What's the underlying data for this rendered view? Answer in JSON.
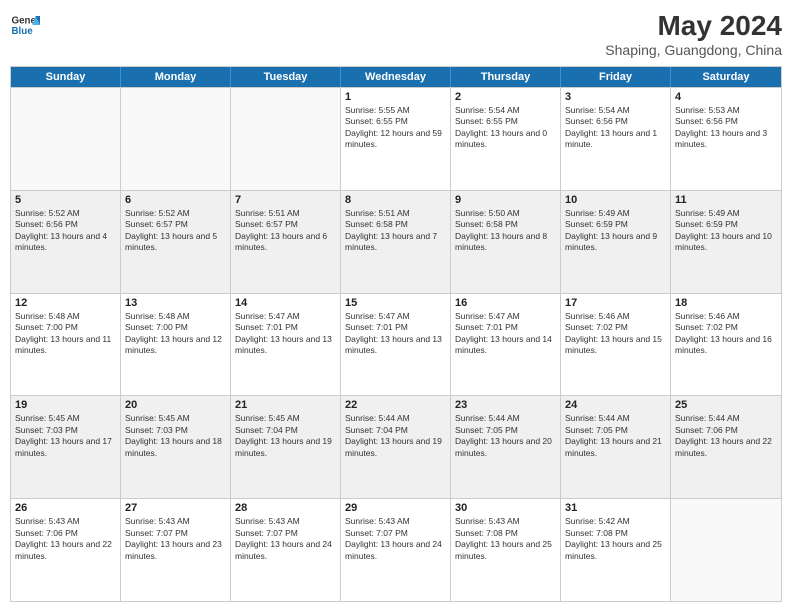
{
  "logo": {
    "line1": "General",
    "line2": "Blue"
  },
  "title": {
    "month_year": "May 2024",
    "location": "Shaping, Guangdong, China"
  },
  "days_of_week": [
    "Sunday",
    "Monday",
    "Tuesday",
    "Wednesday",
    "Thursday",
    "Friday",
    "Saturday"
  ],
  "weeks": [
    [
      {
        "day": "",
        "empty": true
      },
      {
        "day": "",
        "empty": true
      },
      {
        "day": "",
        "empty": true
      },
      {
        "day": "1",
        "sunrise": "5:55 AM",
        "sunset": "6:55 PM",
        "daylight": "12 hours and 59 minutes."
      },
      {
        "day": "2",
        "sunrise": "5:54 AM",
        "sunset": "6:55 PM",
        "daylight": "13 hours and 0 minutes."
      },
      {
        "day": "3",
        "sunrise": "5:54 AM",
        "sunset": "6:56 PM",
        "daylight": "13 hours and 1 minute."
      },
      {
        "day": "4",
        "sunrise": "5:53 AM",
        "sunset": "6:56 PM",
        "daylight": "13 hours and 3 minutes."
      }
    ],
    [
      {
        "day": "5",
        "sunrise": "5:52 AM",
        "sunset": "6:56 PM",
        "daylight": "13 hours and 4 minutes."
      },
      {
        "day": "6",
        "sunrise": "5:52 AM",
        "sunset": "6:57 PM",
        "daylight": "13 hours and 5 minutes."
      },
      {
        "day": "7",
        "sunrise": "5:51 AM",
        "sunset": "6:57 PM",
        "daylight": "13 hours and 6 minutes."
      },
      {
        "day": "8",
        "sunrise": "5:51 AM",
        "sunset": "6:58 PM",
        "daylight": "13 hours and 7 minutes."
      },
      {
        "day": "9",
        "sunrise": "5:50 AM",
        "sunset": "6:58 PM",
        "daylight": "13 hours and 8 minutes."
      },
      {
        "day": "10",
        "sunrise": "5:49 AM",
        "sunset": "6:59 PM",
        "daylight": "13 hours and 9 minutes."
      },
      {
        "day": "11",
        "sunrise": "5:49 AM",
        "sunset": "6:59 PM",
        "daylight": "13 hours and 10 minutes."
      }
    ],
    [
      {
        "day": "12",
        "sunrise": "5:48 AM",
        "sunset": "7:00 PM",
        "daylight": "13 hours and 11 minutes."
      },
      {
        "day": "13",
        "sunrise": "5:48 AM",
        "sunset": "7:00 PM",
        "daylight": "13 hours and 12 minutes."
      },
      {
        "day": "14",
        "sunrise": "5:47 AM",
        "sunset": "7:01 PM",
        "daylight": "13 hours and 13 minutes."
      },
      {
        "day": "15",
        "sunrise": "5:47 AM",
        "sunset": "7:01 PM",
        "daylight": "13 hours and 13 minutes."
      },
      {
        "day": "16",
        "sunrise": "5:47 AM",
        "sunset": "7:01 PM",
        "daylight": "13 hours and 14 minutes."
      },
      {
        "day": "17",
        "sunrise": "5:46 AM",
        "sunset": "7:02 PM",
        "daylight": "13 hours and 15 minutes."
      },
      {
        "day": "18",
        "sunrise": "5:46 AM",
        "sunset": "7:02 PM",
        "daylight": "13 hours and 16 minutes."
      }
    ],
    [
      {
        "day": "19",
        "sunrise": "5:45 AM",
        "sunset": "7:03 PM",
        "daylight": "13 hours and 17 minutes."
      },
      {
        "day": "20",
        "sunrise": "5:45 AM",
        "sunset": "7:03 PM",
        "daylight": "13 hours and 18 minutes."
      },
      {
        "day": "21",
        "sunrise": "5:45 AM",
        "sunset": "7:04 PM",
        "daylight": "13 hours and 19 minutes."
      },
      {
        "day": "22",
        "sunrise": "5:44 AM",
        "sunset": "7:04 PM",
        "daylight": "13 hours and 19 minutes."
      },
      {
        "day": "23",
        "sunrise": "5:44 AM",
        "sunset": "7:05 PM",
        "daylight": "13 hours and 20 minutes."
      },
      {
        "day": "24",
        "sunrise": "5:44 AM",
        "sunset": "7:05 PM",
        "daylight": "13 hours and 21 minutes."
      },
      {
        "day": "25",
        "sunrise": "5:44 AM",
        "sunset": "7:06 PM",
        "daylight": "13 hours and 22 minutes."
      }
    ],
    [
      {
        "day": "26",
        "sunrise": "5:43 AM",
        "sunset": "7:06 PM",
        "daylight": "13 hours and 22 minutes."
      },
      {
        "day": "27",
        "sunrise": "5:43 AM",
        "sunset": "7:07 PM",
        "daylight": "13 hours and 23 minutes."
      },
      {
        "day": "28",
        "sunrise": "5:43 AM",
        "sunset": "7:07 PM",
        "daylight": "13 hours and 24 minutes."
      },
      {
        "day": "29",
        "sunrise": "5:43 AM",
        "sunset": "7:07 PM",
        "daylight": "13 hours and 24 minutes."
      },
      {
        "day": "30",
        "sunrise": "5:43 AM",
        "sunset": "7:08 PM",
        "daylight": "13 hours and 25 minutes."
      },
      {
        "day": "31",
        "sunrise": "5:42 AM",
        "sunset": "7:08 PM",
        "daylight": "13 hours and 25 minutes."
      },
      {
        "day": "",
        "empty": true
      }
    ]
  ]
}
